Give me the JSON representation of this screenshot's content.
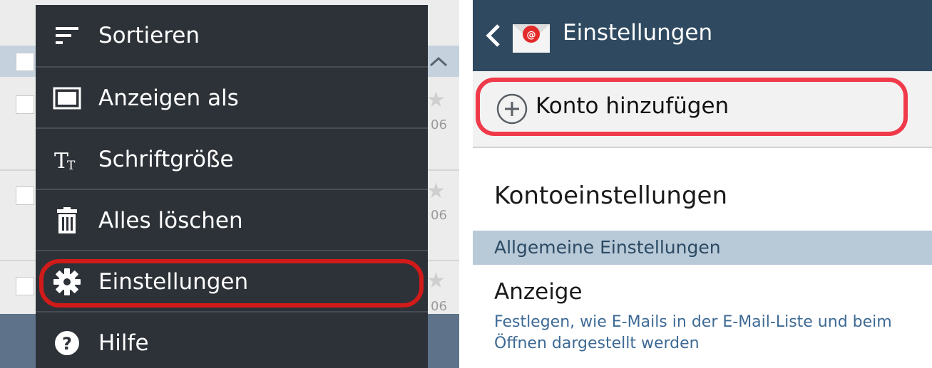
{
  "colors": {
    "menu_bg": "#2d3238",
    "menu_text": "#ffffff",
    "highlight_left": "#d11a1a",
    "highlight_right": "#f03a4a",
    "topbar": "#2f4a60",
    "section_bg": "#b8c9d8",
    "section_text": "#2b4a63",
    "description_text": "#3e6a94"
  },
  "left_panel": {
    "background_list": {
      "rows": [
        {
          "date_fragment": "06"
        },
        {
          "date_fragment": "06"
        },
        {
          "date_fragment": "06"
        }
      ]
    },
    "menu": {
      "items": [
        {
          "label": "Sortieren",
          "icon": "sort-icon"
        },
        {
          "label": "Anzeigen als",
          "icon": "view-as-icon"
        },
        {
          "label": "Schriftgröße",
          "icon": "font-size-icon"
        },
        {
          "label": "Alles löschen",
          "icon": "trash-icon"
        },
        {
          "label": "Einstellungen",
          "icon": "gear-icon",
          "highlighted": true
        },
        {
          "label": "Hilfe",
          "icon": "help-icon"
        }
      ]
    }
  },
  "right_panel": {
    "header": {
      "title": "Einstellungen",
      "back_icon": "chevron-left-icon",
      "app_icon": "email-app-icon"
    },
    "add_account": {
      "label": "Konto hinzufügen",
      "icon": "plus-circle-icon",
      "highlighted": true
    },
    "account_settings": {
      "label": "Kontoeinstellungen"
    },
    "general_section": {
      "label": "Allgemeine Einstellungen"
    },
    "display": {
      "title": "Anzeige",
      "description": "Festlegen, wie E-Mails in der E-Mail-Liste und beim Öffnen dargestellt werden"
    }
  }
}
